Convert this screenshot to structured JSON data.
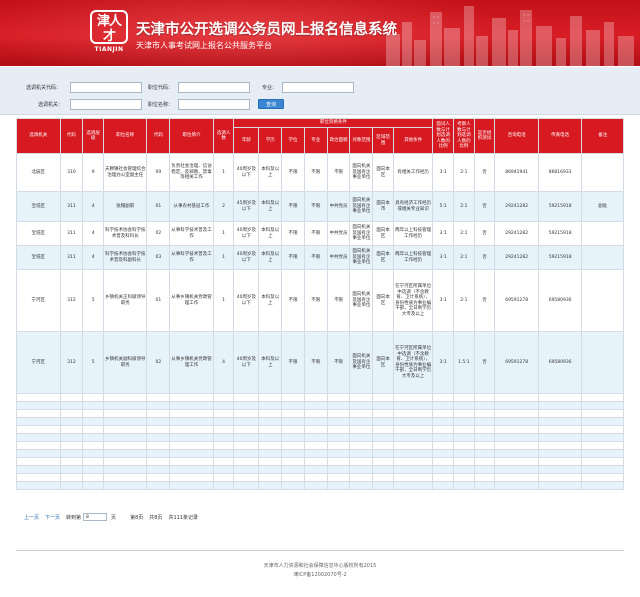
{
  "header": {
    "logo_chars": "津人才",
    "logo_text": "TIANJIN",
    "title": "天津市公开选调公务员网上报名信息系统",
    "subtitle": "天津市人事考试网上报名公共服务平台"
  },
  "search": {
    "unit_code_label": "选调机关代码：",
    "position_code_label": "职位代码：",
    "major_label": "专业：",
    "unit_name_label": "选调机关：",
    "position_name_label": "职位名称：",
    "query_button": "查询"
  },
  "table": {
    "headers": {
      "unit": "选调机关",
      "code": "代码",
      "level": "选调层级",
      "position_name": "职位名称",
      "position_code": "代码",
      "position_intro": "职位简介",
      "count": "选调人数",
      "conditions": "职位资格条件",
      "age": "年龄",
      "education": "学历",
      "degree": "学位",
      "major": "专业",
      "politics": "政治面貌",
      "target": "对象范围",
      "region": "区域范围",
      "other": "其他条件",
      "interview_ratio": "面试人数与计划选调人数的比例",
      "exam_ratio": "考察人数与计划选调人数的比例",
      "skill_test": "是否组织测试",
      "phone": "咨询电话",
      "fax": "传真电话",
      "remark": "备注"
    },
    "rows": [
      {
        "unit": "北辰区",
        "code": "310",
        "level": "9",
        "position_name": "天穆镇社会管理综合治理办公室副主任",
        "position_code": "09",
        "position_intro": "负责社会治理、信访稳定、反邪教、禁毒等相关工作",
        "count": "1",
        "age": "40周岁及以下",
        "education": "本科及以上",
        "degree": "不限",
        "major": "不限",
        "politics": "不限",
        "target": "面向机关及国有企事业单位",
        "region": "面向本区",
        "other": "有相关工作经历",
        "interview_ratio": "3:1",
        "exam_ratio": "2:1",
        "skill_test": "否",
        "phone": "86941941",
        "fax": "86816933",
        "remark": ""
      },
      {
        "unit": "宝坻区",
        "code": "311",
        "level": "4",
        "position_name": "张帽副职",
        "position_code": "01",
        "position_intro": "从事农村基层工作",
        "count": "2",
        "age": "45周岁及以下",
        "education": "本科及以上",
        "degree": "不限",
        "major": "不限",
        "politics": "中共党员",
        "target": "面向机关及国有企事业单位",
        "region": "面向本市",
        "other": "具有经济工作经历或相关专业知识",
        "interview_ratio": "5:1",
        "exam_ratio": "2:1",
        "skill_test": "否",
        "phone": "29241282",
        "fax": "59215918",
        "remark": "副处"
      },
      {
        "unit": "宝坻区",
        "code": "311",
        "level": "4",
        "position_name": "科学技术协会科学技术普及科科长",
        "position_code": "02",
        "position_intro": "从事科学技术普及工作",
        "count": "1",
        "age": "40周岁及以下",
        "education": "本科及以上",
        "degree": "不限",
        "major": "不限",
        "politics": "中共党员",
        "target": "面向机关及国有企事业单位",
        "region": "面向本区",
        "other": "两年以上科技管理工作经历",
        "interview_ratio": "3:1",
        "exam_ratio": "2:1",
        "skill_test": "否",
        "phone": "29241282",
        "fax": "59215918",
        "remark": ""
      },
      {
        "unit": "宝坻区",
        "code": "311",
        "level": "4",
        "position_name": "科学技术协会科学技术普及科副科长",
        "position_code": "03",
        "position_intro": "从事科学技术普及工作",
        "count": "1",
        "age": "40周岁及以下",
        "education": "本科及以上",
        "degree": "不限",
        "major": "不限",
        "politics": "中共党员",
        "target": "面向机关及国有企事业单位",
        "region": "面向本区",
        "other": "两年以上科技管理工作经历",
        "interview_ratio": "3:1",
        "exam_ratio": "2:1",
        "skill_test": "否",
        "phone": "29241282",
        "fax": "59215918",
        "remark": ""
      },
      {
        "unit": "宁河区",
        "code": "312",
        "level": "5",
        "position_name": "乡镇机关正科级领导职务",
        "position_code": "01",
        "position_intro": "从事乡镇机关党政管理工作",
        "count": "1",
        "age": "40周岁及以下",
        "education": "本科及以上",
        "degree": "不限",
        "major": "不限",
        "politics": "不限",
        "target": "面向机关及国有企事业单位",
        "region": "面向本区",
        "other": "在宁河区所属单位中选调（不含教育、卫计系统），身份性质为事业编干部，全日制学历大专及以上",
        "interview_ratio": "3:1",
        "exam_ratio": "2:1",
        "skill_test": "否",
        "phone": "69591278",
        "fax": "69580936",
        "remark": ""
      },
      {
        "unit": "宁河区",
        "code": "312",
        "level": "5",
        "position_name": "乡镇机关副科级领导职务",
        "position_code": "02",
        "position_intro": "从事乡镇机关党政管理工作",
        "count": "4",
        "age": "40周岁及以下",
        "education": "本科及以上",
        "degree": "不限",
        "major": "不限",
        "politics": "不限",
        "target": "面向机关及国有企事业单位",
        "region": "面向本区",
        "other": "在宁河区所属单位中选调（不含教育、卫计系统），身份性质为事业编干部，全日制学历大专及以上",
        "interview_ratio": "3:1",
        "exam_ratio": "1.5:1",
        "skill_test": "否",
        "phone": "69591278",
        "fax": "69580936",
        "remark": ""
      }
    ]
  },
  "pagination": {
    "prev": "上一页",
    "next": "下一页",
    "goto_label": "转到第",
    "goto_value": "8",
    "page_unit": "页",
    "current": "第8页",
    "total_pages": "共8页",
    "total_records": "共111条记录"
  },
  "footer": {
    "copyright": "天津市人力资源和社会保障信息中心版权所有2015",
    "icp": "津ICP备12002070号-2"
  },
  "colors": {
    "header_red": "#d81d25",
    "table_header_red": "#d71a21",
    "search_bg": "#e7edf5",
    "stripe_blue": "#e6f3fb",
    "button_blue": "#3a86d2"
  }
}
